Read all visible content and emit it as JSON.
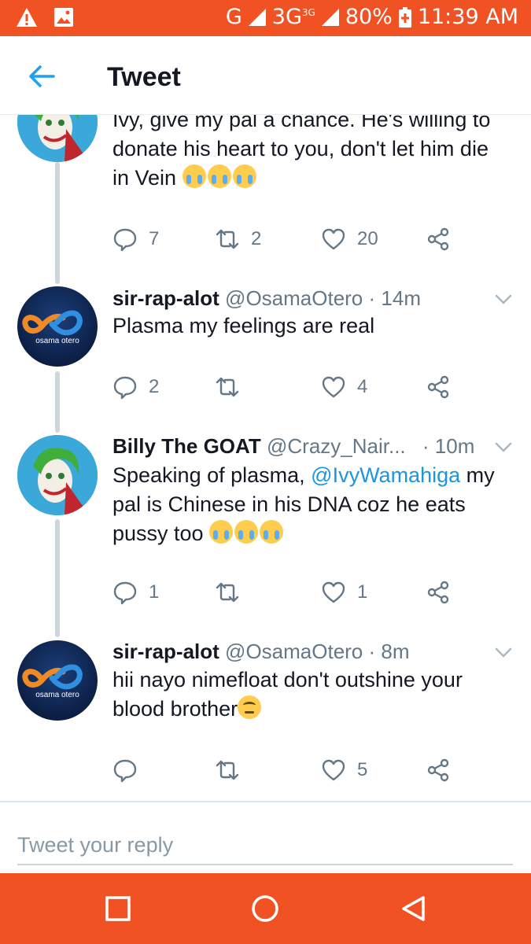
{
  "status_bar": {
    "network": "G",
    "network2": "3G",
    "network2_sup": "3G",
    "battery": "80%",
    "time": "11:39 AM",
    "bg_color": "#f05223"
  },
  "header": {
    "title": "Tweet",
    "back_icon": "arrow-left-icon"
  },
  "tweets": [
    {
      "text_partial": "Ivy, give my pal a chance. He's willing to donate his heart to you, don't let him die in Vein",
      "emoji": "loudly-crying-face x3",
      "replies": "7",
      "retweets": "2",
      "likes": "20"
    },
    {
      "name": "sir-rap-alot",
      "handle": "@OsamaOtero",
      "time": "· 14m",
      "text": "Plasma my feelings are real",
      "replies": "2",
      "retweets": "",
      "likes": "4",
      "avatar_text": "osama otero"
    },
    {
      "name": "Billy The GOAT",
      "handle": "@Crazy_Nair...",
      "time": "· 10m",
      "text_before": "Speaking of plasma, ",
      "mention": "@IvyWamahiga",
      "text_after": " my pal is Chinese in his DNA coz he eats pussy too",
      "emoji": "loudly-crying-face x3",
      "replies": "1",
      "retweets": "",
      "likes": "1"
    },
    {
      "name": "sir-rap-alot",
      "handle": "@OsamaOtero",
      "time": "· 8m",
      "text": "hii nayo nimefloat don't outshine your blood brother",
      "emoji": "face-with-rolling-eyes",
      "replies": "",
      "retweets": "",
      "likes": "5",
      "avatar_text": "osama otero"
    }
  ],
  "reply_box": {
    "placeholder": "Tweet your reply"
  },
  "nav_bar": {
    "buttons": [
      "recents-square-icon",
      "home-circle-icon",
      "back-triangle-icon"
    ]
  },
  "colors": {
    "accent": "#1da1f2",
    "mention": "#1b95e0",
    "muted": "#657786",
    "android_orange": "#f05223"
  }
}
